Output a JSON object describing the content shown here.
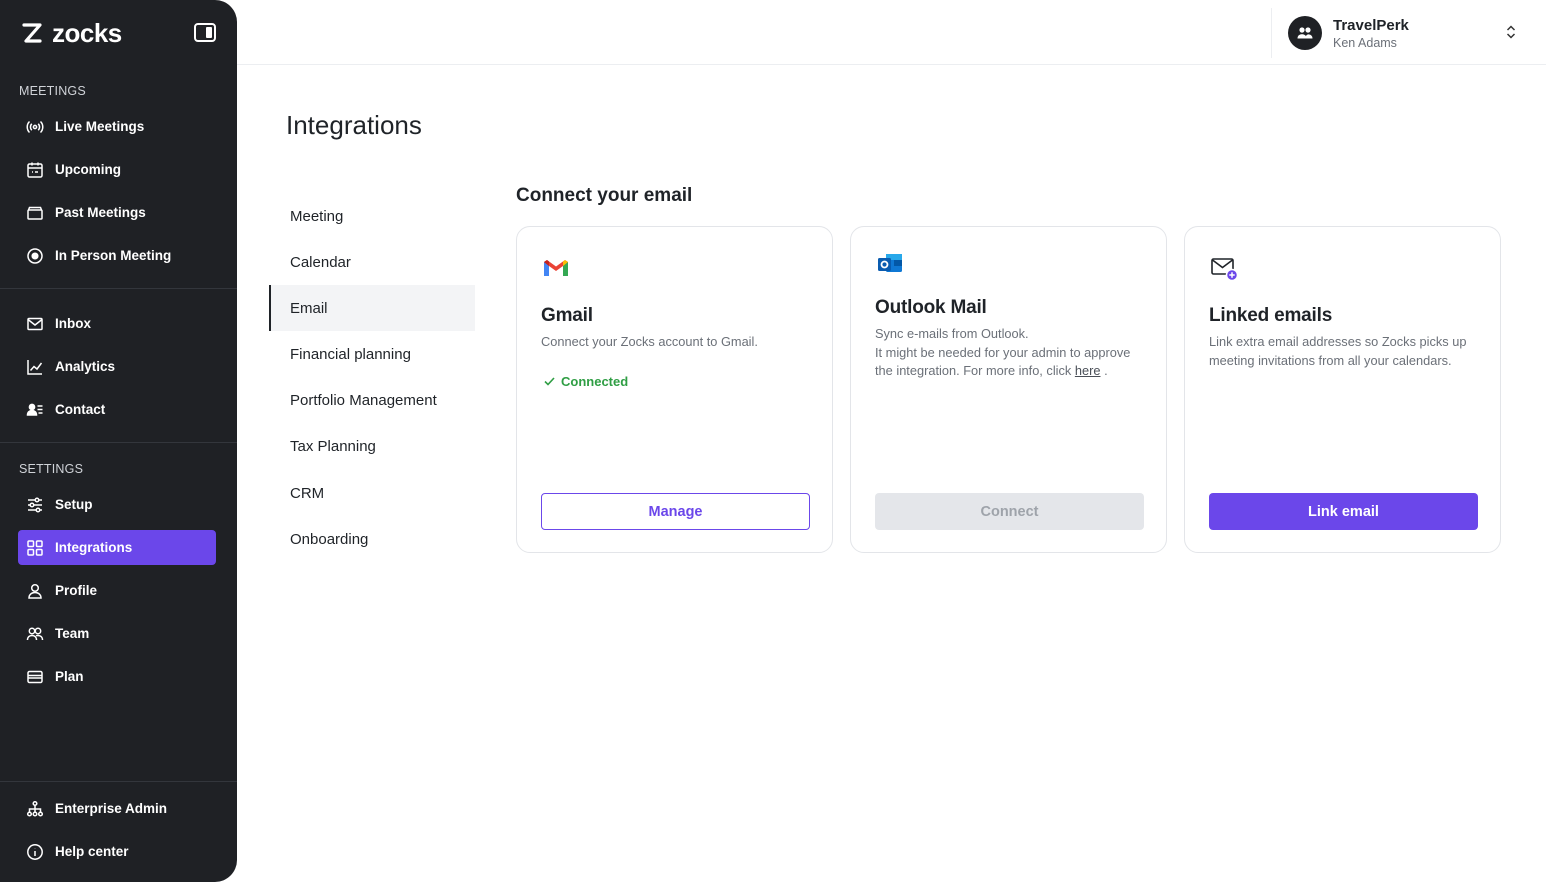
{
  "app": {
    "logo_text": "zocks"
  },
  "sidebar": {
    "meetings_label": "MEETINGS",
    "settings_label": "SETTINGS",
    "meetings": [
      {
        "label": "Live Meetings",
        "icon": "broadcast-icon"
      },
      {
        "label": "Upcoming",
        "icon": "calendar-icon"
      },
      {
        "label": "Past Meetings",
        "icon": "archive-icon"
      },
      {
        "label": "In Person Meeting",
        "icon": "record-icon"
      }
    ],
    "tools": [
      {
        "label": "Inbox",
        "icon": "mail-icon"
      },
      {
        "label": "Analytics",
        "icon": "chart-icon"
      },
      {
        "label": "Contact",
        "icon": "contact-icon"
      }
    ],
    "settings": [
      {
        "label": "Setup",
        "icon": "sliders-icon"
      },
      {
        "label": "Integrations",
        "icon": "grid-icon",
        "active": true
      },
      {
        "label": "Profile",
        "icon": "user-icon"
      },
      {
        "label": "Team",
        "icon": "team-icon"
      },
      {
        "label": "Plan",
        "icon": "card-icon"
      }
    ],
    "footer": [
      {
        "label": "Enterprise Admin",
        "icon": "org-chart-icon"
      },
      {
        "label": "Help center",
        "icon": "info-icon"
      }
    ]
  },
  "account": {
    "org": "TravelPerk",
    "user": "Ken Adams"
  },
  "page": {
    "title": "Integrations"
  },
  "subnav": [
    {
      "label": "Meeting"
    },
    {
      "label": "Calendar"
    },
    {
      "label": "Email",
      "active": true
    },
    {
      "label": "Financial planning"
    },
    {
      "label": "Portfolio Management"
    },
    {
      "label": "Tax Planning"
    },
    {
      "label": "CRM"
    },
    {
      "label": "Onboarding"
    }
  ],
  "email_section": {
    "title": "Connect your email",
    "cards": {
      "gmail": {
        "title": "Gmail",
        "description": "Connect your Zocks account to Gmail.",
        "status": "Connected",
        "button": "Manage"
      },
      "outlook": {
        "title": "Outlook Mail",
        "line1": "Sync e-mails from Outlook.",
        "line2": "It might be needed for your admin to approve the integration. For more info, click",
        "link": "here",
        "line2_end": ".",
        "button": "Connect"
      },
      "linked": {
        "title": "Linked emails",
        "description": "Link extra email addresses so Zocks picks up meeting invitations from all your calendars.",
        "button": "Link email"
      }
    }
  },
  "colors": {
    "sidebar_bg": "#1f2125",
    "accent": "#6b47ea",
    "success": "#2f9e44"
  }
}
